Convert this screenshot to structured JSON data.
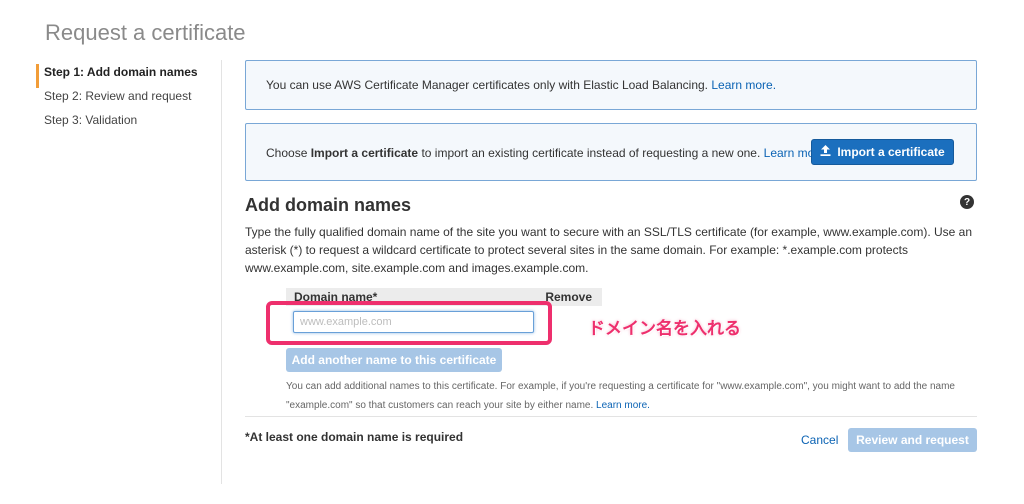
{
  "page": {
    "title": "Request a certificate"
  },
  "steps": [
    {
      "label": "Step 1: Add domain names"
    },
    {
      "label": "Step 2: Review and request"
    },
    {
      "label": "Step 3: Validation"
    }
  ],
  "info1": {
    "text": "You can use AWS Certificate Manager certificates only with Elastic Load Balancing.",
    "link": "Learn more."
  },
  "info2": {
    "prefix": "Choose",
    "bold": "Import a certificate",
    "suffix": "to import an existing certificate instead of requesting a new one.",
    "link": "Learn more.",
    "button": "Import a certificate"
  },
  "section": {
    "title": "Add domain names",
    "help_icon": "?",
    "description": "Type the fully qualified domain name of the site you want to secure with an SSL/TLS certificate (for example, www.example.com). Use an asterisk (*) to request a wildcard certificate to protect several sites in the same domain. For example: *.example.com protects www.example.com, site.example.com and images.example.com."
  },
  "table": {
    "col_domain": "Domain name*",
    "col_remove": "Remove",
    "input_value": "",
    "input_placeholder": "www.example.com"
  },
  "annotation": "ドメイン名を入れる",
  "add_button": "Add another name to this certificate",
  "note": {
    "text": "You can add additional names to this certificate. For example, if you're requesting a certificate for \"www.example.com\", you might want to add the name \"example.com\" so that customers can reach your site by either name.",
    "link": "Learn more."
  },
  "footer": {
    "required": "*At least one domain name is required",
    "cancel": "Cancel",
    "review": "Review and request"
  },
  "colors": {
    "accent": "#1b6fbe",
    "active_step": "#f29d38",
    "highlight": "#ee2f6d",
    "disabled_button": "#a7c6e6"
  }
}
